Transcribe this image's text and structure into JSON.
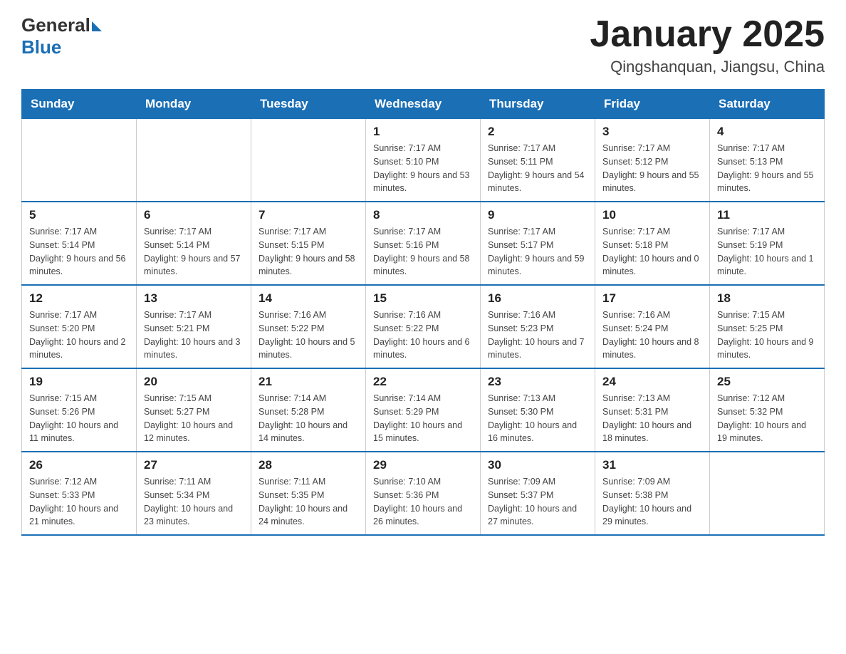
{
  "header": {
    "logo_general": "General",
    "logo_blue": "Blue",
    "title": "January 2025",
    "subtitle": "Qingshanquan, Jiangsu, China"
  },
  "days_of_week": [
    "Sunday",
    "Monday",
    "Tuesday",
    "Wednesday",
    "Thursday",
    "Friday",
    "Saturday"
  ],
  "weeks": [
    [
      {
        "day": "",
        "info": ""
      },
      {
        "day": "",
        "info": ""
      },
      {
        "day": "",
        "info": ""
      },
      {
        "day": "1",
        "info": "Sunrise: 7:17 AM\nSunset: 5:10 PM\nDaylight: 9 hours\nand 53 minutes."
      },
      {
        "day": "2",
        "info": "Sunrise: 7:17 AM\nSunset: 5:11 PM\nDaylight: 9 hours\nand 54 minutes."
      },
      {
        "day": "3",
        "info": "Sunrise: 7:17 AM\nSunset: 5:12 PM\nDaylight: 9 hours\nand 55 minutes."
      },
      {
        "day": "4",
        "info": "Sunrise: 7:17 AM\nSunset: 5:13 PM\nDaylight: 9 hours\nand 55 minutes."
      }
    ],
    [
      {
        "day": "5",
        "info": "Sunrise: 7:17 AM\nSunset: 5:14 PM\nDaylight: 9 hours\nand 56 minutes."
      },
      {
        "day": "6",
        "info": "Sunrise: 7:17 AM\nSunset: 5:14 PM\nDaylight: 9 hours\nand 57 minutes."
      },
      {
        "day": "7",
        "info": "Sunrise: 7:17 AM\nSunset: 5:15 PM\nDaylight: 9 hours\nand 58 minutes."
      },
      {
        "day": "8",
        "info": "Sunrise: 7:17 AM\nSunset: 5:16 PM\nDaylight: 9 hours\nand 58 minutes."
      },
      {
        "day": "9",
        "info": "Sunrise: 7:17 AM\nSunset: 5:17 PM\nDaylight: 9 hours\nand 59 minutes."
      },
      {
        "day": "10",
        "info": "Sunrise: 7:17 AM\nSunset: 5:18 PM\nDaylight: 10 hours\nand 0 minutes."
      },
      {
        "day": "11",
        "info": "Sunrise: 7:17 AM\nSunset: 5:19 PM\nDaylight: 10 hours\nand 1 minute."
      }
    ],
    [
      {
        "day": "12",
        "info": "Sunrise: 7:17 AM\nSunset: 5:20 PM\nDaylight: 10 hours\nand 2 minutes."
      },
      {
        "day": "13",
        "info": "Sunrise: 7:17 AM\nSunset: 5:21 PM\nDaylight: 10 hours\nand 3 minutes."
      },
      {
        "day": "14",
        "info": "Sunrise: 7:16 AM\nSunset: 5:22 PM\nDaylight: 10 hours\nand 5 minutes."
      },
      {
        "day": "15",
        "info": "Sunrise: 7:16 AM\nSunset: 5:22 PM\nDaylight: 10 hours\nand 6 minutes."
      },
      {
        "day": "16",
        "info": "Sunrise: 7:16 AM\nSunset: 5:23 PM\nDaylight: 10 hours\nand 7 minutes."
      },
      {
        "day": "17",
        "info": "Sunrise: 7:16 AM\nSunset: 5:24 PM\nDaylight: 10 hours\nand 8 minutes."
      },
      {
        "day": "18",
        "info": "Sunrise: 7:15 AM\nSunset: 5:25 PM\nDaylight: 10 hours\nand 9 minutes."
      }
    ],
    [
      {
        "day": "19",
        "info": "Sunrise: 7:15 AM\nSunset: 5:26 PM\nDaylight: 10 hours\nand 11 minutes."
      },
      {
        "day": "20",
        "info": "Sunrise: 7:15 AM\nSunset: 5:27 PM\nDaylight: 10 hours\nand 12 minutes."
      },
      {
        "day": "21",
        "info": "Sunrise: 7:14 AM\nSunset: 5:28 PM\nDaylight: 10 hours\nand 14 minutes."
      },
      {
        "day": "22",
        "info": "Sunrise: 7:14 AM\nSunset: 5:29 PM\nDaylight: 10 hours\nand 15 minutes."
      },
      {
        "day": "23",
        "info": "Sunrise: 7:13 AM\nSunset: 5:30 PM\nDaylight: 10 hours\nand 16 minutes."
      },
      {
        "day": "24",
        "info": "Sunrise: 7:13 AM\nSunset: 5:31 PM\nDaylight: 10 hours\nand 18 minutes."
      },
      {
        "day": "25",
        "info": "Sunrise: 7:12 AM\nSunset: 5:32 PM\nDaylight: 10 hours\nand 19 minutes."
      }
    ],
    [
      {
        "day": "26",
        "info": "Sunrise: 7:12 AM\nSunset: 5:33 PM\nDaylight: 10 hours\nand 21 minutes."
      },
      {
        "day": "27",
        "info": "Sunrise: 7:11 AM\nSunset: 5:34 PM\nDaylight: 10 hours\nand 23 minutes."
      },
      {
        "day": "28",
        "info": "Sunrise: 7:11 AM\nSunset: 5:35 PM\nDaylight: 10 hours\nand 24 minutes."
      },
      {
        "day": "29",
        "info": "Sunrise: 7:10 AM\nSunset: 5:36 PM\nDaylight: 10 hours\nand 26 minutes."
      },
      {
        "day": "30",
        "info": "Sunrise: 7:09 AM\nSunset: 5:37 PM\nDaylight: 10 hours\nand 27 minutes."
      },
      {
        "day": "31",
        "info": "Sunrise: 7:09 AM\nSunset: 5:38 PM\nDaylight: 10 hours\nand 29 minutes."
      },
      {
        "day": "",
        "info": ""
      }
    ]
  ]
}
